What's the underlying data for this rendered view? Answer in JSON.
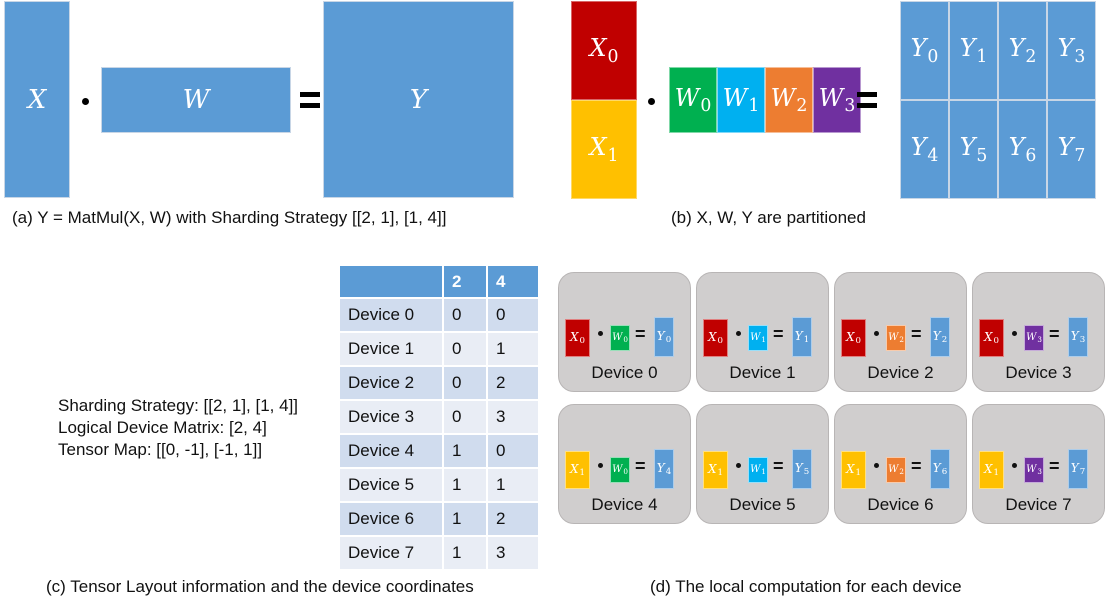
{
  "colors": {
    "blue": "#5b9bd5",
    "red": "#c00000",
    "yellow": "#ffc000",
    "green": "#00b050",
    "cyan": "#00b0f0",
    "orange": "#ed7d31",
    "purple": "#7030a0",
    "card_bg": "#d0cece"
  },
  "panel_a": {
    "x_label": "X",
    "w_label": "W",
    "y_label": "Y",
    "dot": "•",
    "equals": "=",
    "caption": "(a) Y = MatMul(X, W) with Sharding Strategy [[2, 1], [1, 4]]"
  },
  "panel_b": {
    "x_parts": [
      {
        "base": "X",
        "sub": "0",
        "color": "#c00000"
      },
      {
        "base": "X",
        "sub": "1",
        "color": "#ffc000"
      }
    ],
    "w_parts": [
      {
        "base": "W",
        "sub": "0",
        "color": "#00b050"
      },
      {
        "base": "W",
        "sub": "1",
        "color": "#00b0f0"
      },
      {
        "base": "W",
        "sub": "2",
        "color": "#ed7d31"
      },
      {
        "base": "W",
        "sub": "3",
        "color": "#7030a0"
      }
    ],
    "y_parts": [
      {
        "base": "Y",
        "sub": "0"
      },
      {
        "base": "Y",
        "sub": "1"
      },
      {
        "base": "Y",
        "sub": "2"
      },
      {
        "base": "Y",
        "sub": "3"
      },
      {
        "base": "Y",
        "sub": "4"
      },
      {
        "base": "Y",
        "sub": "5"
      },
      {
        "base": "Y",
        "sub": "6"
      },
      {
        "base": "Y",
        "sub": "7"
      }
    ],
    "dot": "•",
    "equals": "=",
    "caption": "(b) X, W, Y are partitioned"
  },
  "panel_c": {
    "info_lines": [
      "Sharding Strategy: [[2, 1], [1, 4]]",
      "Logical Device Matrix: [2, 4]",
      "Tensor Map: [[0, -1], [-1, 1]]"
    ],
    "table": {
      "headers": [
        "",
        "2",
        "4"
      ],
      "rows": [
        [
          "Device 0",
          "0",
          "0"
        ],
        [
          "Device 1",
          "0",
          "1"
        ],
        [
          "Device 2",
          "0",
          "2"
        ],
        [
          "Device 3",
          "0",
          "3"
        ],
        [
          "Device 4",
          "1",
          "0"
        ],
        [
          "Device 5",
          "1",
          "1"
        ],
        [
          "Device 6",
          "1",
          "2"
        ],
        [
          "Device 7",
          "1",
          "3"
        ]
      ]
    },
    "caption": "(c) Tensor Layout information and the device coordinates"
  },
  "panel_d": {
    "devices": [
      {
        "label": "Device 0",
        "x": "0",
        "w": "0",
        "y": "0"
      },
      {
        "label": "Device 1",
        "x": "0",
        "w": "1",
        "y": "1"
      },
      {
        "label": "Device 2",
        "x": "0",
        "w": "2",
        "y": "2"
      },
      {
        "label": "Device 3",
        "x": "0",
        "w": "3",
        "y": "3"
      },
      {
        "label": "Device 4",
        "x": "1",
        "w": "0",
        "y": "4"
      },
      {
        "label": "Device 5",
        "x": "1",
        "w": "1",
        "y": "5"
      },
      {
        "label": "Device 6",
        "x": "1",
        "w": "2",
        "y": "6"
      },
      {
        "label": "Device 7",
        "x": "1",
        "w": "3",
        "y": "7"
      }
    ],
    "equals": "=",
    "caption": "(d) The local computation for each device"
  }
}
